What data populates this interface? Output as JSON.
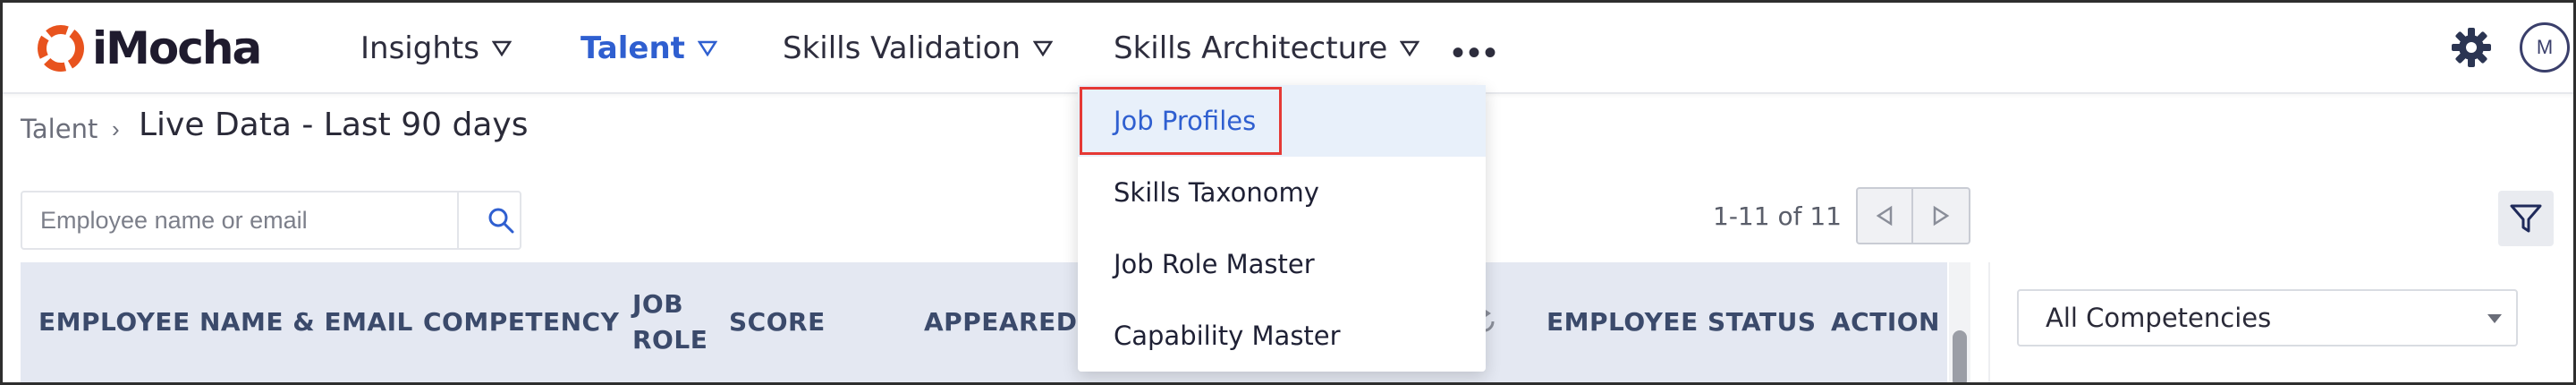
{
  "app": {
    "brand": "iMocha"
  },
  "nav": {
    "items": [
      {
        "label": "Insights"
      },
      {
        "label": "Talent"
      },
      {
        "label": "Skills Validation"
      },
      {
        "label": "Skills Architecture"
      }
    ],
    "more_label": "•••",
    "avatar_initial": "M"
  },
  "breadcrumb": {
    "parent": "Talent",
    "separator": "›",
    "current": "Live Data - Last 90 days"
  },
  "search": {
    "placeholder": "Employee name or email",
    "value": ""
  },
  "pager": {
    "text": "1-11 of 11"
  },
  "table": {
    "columns": [
      {
        "label": "EMPLOYEE NAME & EMAIL"
      },
      {
        "label": "COMPETENCY"
      },
      {
        "label": "JOB"
      },
      {
        "label": "ROLE"
      },
      {
        "label": "SCORE"
      },
      {
        "label": "APPEARED O"
      },
      {
        "label": "EMPLOYEE STATUS"
      },
      {
        "label": "ACTION"
      }
    ]
  },
  "right_panel": {
    "competency_select": "All Competencies"
  },
  "dropdown": {
    "items": [
      {
        "label": "Job Profiles",
        "selected": true
      },
      {
        "label": "Skills Taxonomy"
      },
      {
        "label": "Job Role Master"
      },
      {
        "label": "Capability Master"
      }
    ]
  },
  "colors": {
    "accent": "#2f5fd0",
    "brand_orange": "#e8531e",
    "header_bg": "#e4e8f2",
    "highlight_border": "#e53935"
  },
  "icons": {
    "logo": "imocha-logo-icon",
    "caret": "chevron-down-icon",
    "settings": "gear-icon",
    "search": "search-icon",
    "prev": "triangle-left-icon",
    "next": "triangle-right-icon",
    "filter": "funnel-icon",
    "refresh": "refresh-icon"
  }
}
